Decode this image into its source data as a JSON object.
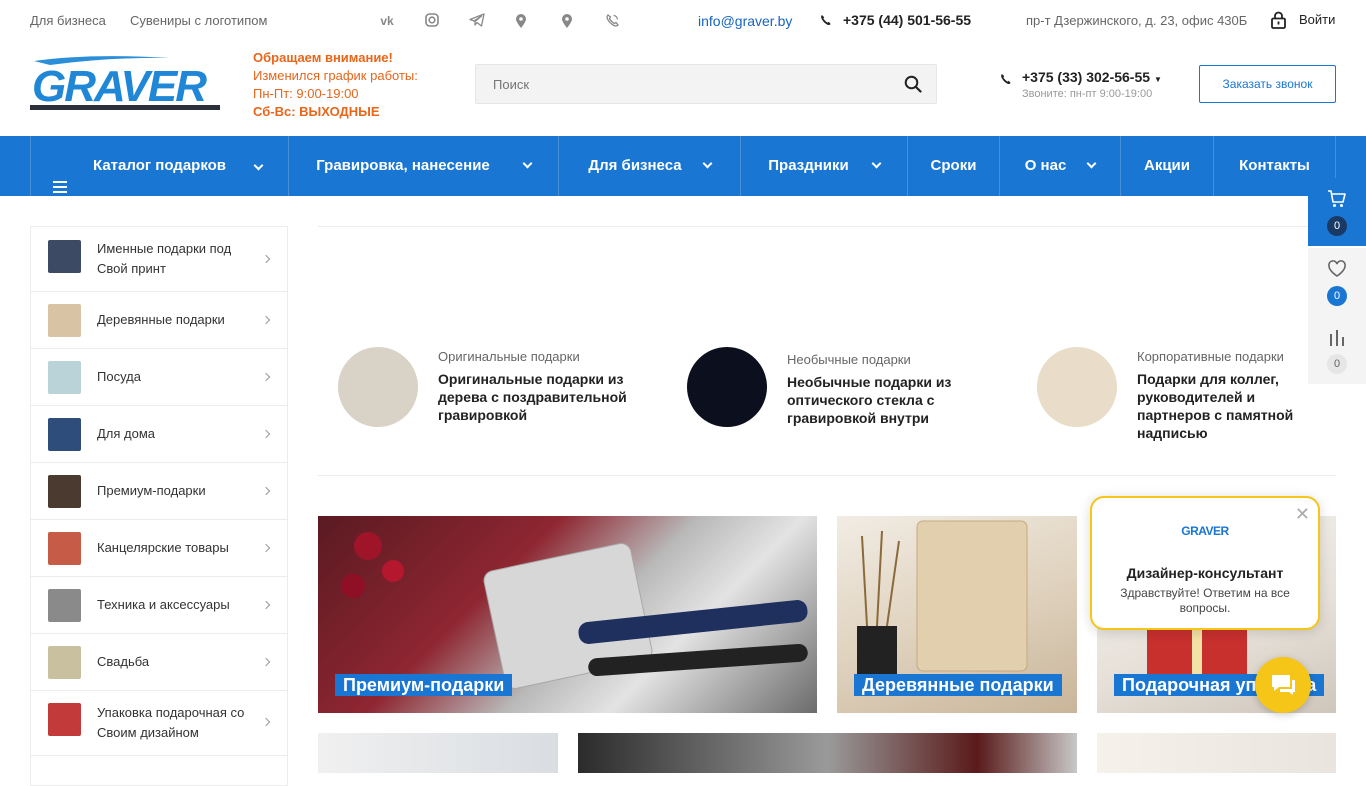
{
  "topbar": {
    "links": [
      "Для бизнеса",
      "Сувениры с логотипом"
    ],
    "social_icons": [
      "vk-icon",
      "instagram-icon",
      "telegram-icon",
      "map-pin-icon",
      "map-pin-icon",
      "viber-icon"
    ],
    "email": "info@graver.by",
    "phone": "+375 (44) 501-56-55",
    "address": "пр-т Дзержинского, д. 23, офис 430Б",
    "login": "Войти"
  },
  "header": {
    "logo_text": "GRAVER",
    "notice": {
      "line1": "Обращаем внимание!",
      "line2": "Изменился график работы:",
      "line3": "Пн-Пт: 9:00-19:00",
      "line4": "Сб-Вс: ВЫХОДНЫЕ"
    },
    "search_placeholder": "Поиск",
    "phone": "+375 (33) 302-56-55",
    "phone_note": "Звоните: пн-пт 9:00-19:00",
    "callback_button": "Заказать звонок"
  },
  "nav": [
    {
      "label": "Каталог подарков",
      "dropdown": true
    },
    {
      "label": "Гравировка, нанесение",
      "dropdown": true
    },
    {
      "label": "Для бизнеса",
      "dropdown": true
    },
    {
      "label": "Праздники",
      "dropdown": true
    },
    {
      "label": "Сроки",
      "dropdown": false
    },
    {
      "label": "О нас",
      "dropdown": true
    },
    {
      "label": "Акции",
      "dropdown": false
    },
    {
      "label": "Контакты",
      "dropdown": false
    }
  ],
  "sidebar": [
    {
      "label": "Именные подарки под Свой принт",
      "color": "#3d4a63"
    },
    {
      "label": "Деревянные подарки",
      "color": "#d9c3a5"
    },
    {
      "label": "Посуда",
      "color": "#b9d3d8"
    },
    {
      "label": "Для дома",
      "color": "#2e4d7a"
    },
    {
      "label": "Премиум-подарки",
      "color": "#4a3a30"
    },
    {
      "label": "Канцелярские товары",
      "color": "#c65b48"
    },
    {
      "label": "Техника и аксессуары",
      "color": "#8a8a8a"
    },
    {
      "label": "Свадьба",
      "color": "#c9c0a0"
    },
    {
      "label": "Упаковка подарочная со Своим дизайном",
      "color": "#c23a3a"
    }
  ],
  "teasers": [
    {
      "category": "Оригинальные подарки",
      "title": "Оригинальные подарки из дерева с поздравительной гравировкой",
      "color": "#d8d2c7"
    },
    {
      "category": "Необычные подарки",
      "title": "Необычные подарки из оптического стекла с гравировкой внутри",
      "color": "#0b0f1e"
    },
    {
      "category": "Корпоративные подарки",
      "title": "Подарки для коллег, руководителей и партнеров с памятной надписью",
      "color": "#e9dcc8"
    }
  ],
  "tiles": [
    {
      "caption": "Премиум-подарки"
    },
    {
      "caption": "Деревянные подарки"
    },
    {
      "caption": "Подарочная упаковка"
    }
  ],
  "right_panel": {
    "cart_count": "0",
    "favorites_count": "0",
    "compare_count": "0"
  },
  "chat": {
    "logo": "GRAVER",
    "title": "Дизайнер-консультант",
    "message": "Здравствуйте! Ответим на все вопросы."
  },
  "colors": {
    "accent": "#1976d2",
    "notice": "#e8651a",
    "chat": "#f5c518"
  }
}
